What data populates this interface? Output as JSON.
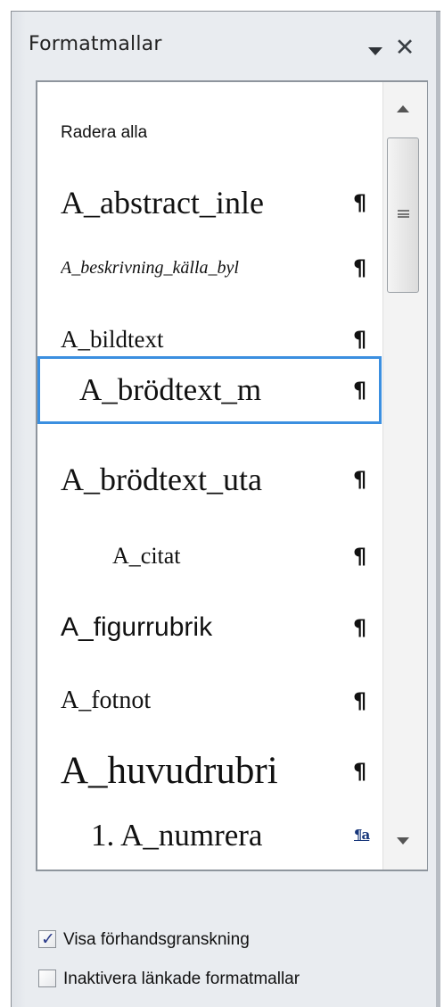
{
  "pane": {
    "title": "Formatmallar",
    "icons": {
      "dropdown": "dropdown-arrow-icon",
      "close": "close-icon"
    }
  },
  "styles": [
    {
      "name": "Radera alla",
      "marker": ""
    },
    {
      "name": "A_abstract_inle",
      "marker": "¶"
    },
    {
      "name": "A_beskrivning_källa_byl",
      "marker": "¶"
    },
    {
      "name": "A_bildtext",
      "marker": "¶"
    },
    {
      "name": "A_brödtext_m",
      "marker": "¶"
    },
    {
      "name": "A_brödtext_uta",
      "marker": "¶"
    },
    {
      "name": "A_citat",
      "marker": "¶"
    },
    {
      "name": "A_figurrubrik",
      "marker": "¶"
    },
    {
      "name": "A_fotnot",
      "marker": "¶"
    },
    {
      "name": "A_huvudrubri",
      "marker": "¶"
    },
    {
      "name": "1. A_numrera",
      "marker": "¶a"
    }
  ],
  "selected_style": "A_brödtext_m",
  "options": {
    "preview": {
      "label": "Visa förhandsgranskning",
      "checked": true,
      "check_glyph": "✓"
    },
    "disable_linked": {
      "label": "Inaktivera länkade formatmallar",
      "checked": false
    }
  },
  "scrollbar": {
    "position_fraction": 0.0
  }
}
